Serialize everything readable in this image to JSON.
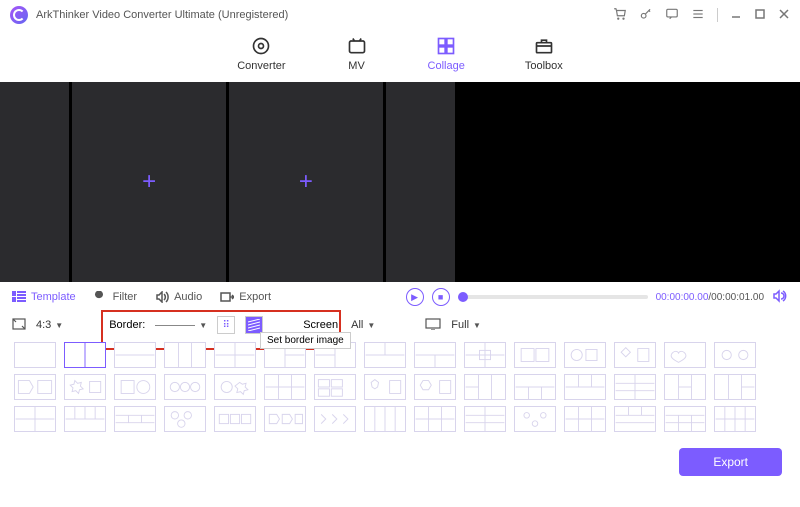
{
  "titlebar": {
    "title": "ArkThinker Video Converter Ultimate (Unregistered)"
  },
  "nav": {
    "converter": "Converter",
    "mv": "MV",
    "collage": "Collage",
    "toolbox": "Toolbox"
  },
  "tabs": {
    "template": "Template",
    "filter": "Filter",
    "audio": "Audio",
    "export": "Export"
  },
  "time": {
    "current": "00:00:00.00",
    "sep": "/",
    "total": "00:00:01.00"
  },
  "options": {
    "ratio": "4:3",
    "border_label": "Border:",
    "screen_label": "Screen:",
    "screen_value": "All",
    "display_value": "Full",
    "border_tooltip": "Set border image"
  },
  "footer": {
    "export": "Export"
  }
}
